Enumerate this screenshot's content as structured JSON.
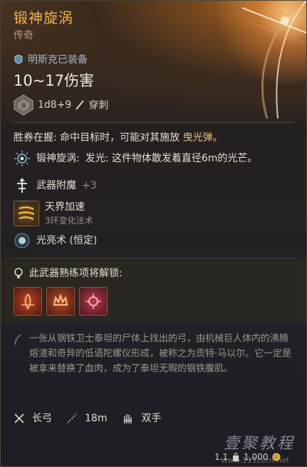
{
  "item": {
    "name": "锻神旋涡",
    "rarity": "传奇",
    "equipped_text": "明斯克已装备",
    "damage": "10~17伤害",
    "die_face": "8",
    "dice": "1d8+9",
    "damage_type": "穿刺"
  },
  "passive": {
    "text": "胜券在握: 命中目标时，可能对其施放",
    "highlight": "曳光弹。"
  },
  "effect": {
    "label": "锻神旋涡:",
    "text": "发光: 这件物体散发着直径6m的光芒。"
  },
  "enchant": {
    "label": "武器附魔",
    "bonus": "+3"
  },
  "spell": {
    "name": "天界加速",
    "type": "3环变化法术"
  },
  "cantrip": {
    "name": "光亮术 (恒定)"
  },
  "mastery": {
    "title": "此武器熟练项将解锁:"
  },
  "lore": {
    "text": "一张从钢铁卫士泰坦的尸体上找出的弓，由机械巨人体内的沸腾熔渣和奇异的低语陀螺仪形成，被称之为贡特·马以尔。它一定是被拿来替换了血肉，成为了泰坦无暇的钢铁腹肌。"
  },
  "footer": {
    "type": "长弓",
    "range": "18m",
    "hands": "双手",
    "weight": "1.1",
    "price": "1,000"
  },
  "watermark": {
    "text": "壹聚教程",
    "url": "www.111com.net"
  },
  "colors": {
    "title": "#f0b24a",
    "highlight": "#e9c27a",
    "mastery_border": "#b4483a"
  }
}
